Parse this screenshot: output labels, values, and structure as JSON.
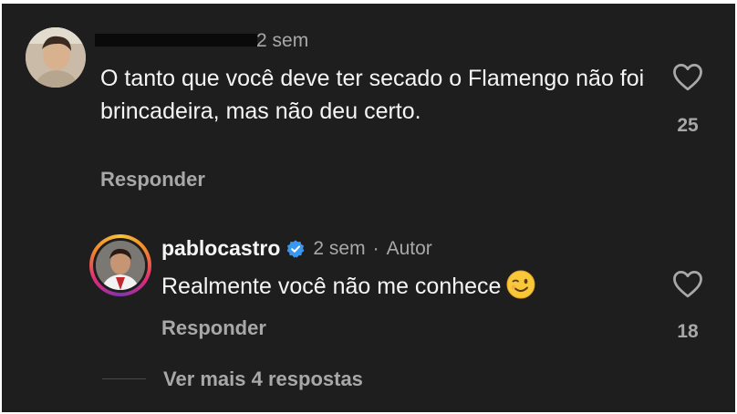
{
  "comment": {
    "time": "2 sem",
    "text": "O tanto que você deve ter secado o Flamengo não foi brincadeira, mas não deu certo.",
    "reply_label": "Responder",
    "like_count": "25",
    "avatar_icon": "user-avatar"
  },
  "reply": {
    "username": "pablocastro",
    "verified_icon": "verified-badge",
    "time": "2 sem",
    "separator": "·",
    "author_tag": "Autor",
    "text": "Realmente você não me conhece",
    "emoji": "winking-face",
    "reply_label": "Responder",
    "like_count": "18"
  },
  "view_more": {
    "label": "Ver mais 4 respostas"
  },
  "colors": {
    "background": "#1e1e1f",
    "text_primary": "#f5f5f5",
    "text_secondary": "#a8a8a8",
    "verified": "#3897f0"
  }
}
